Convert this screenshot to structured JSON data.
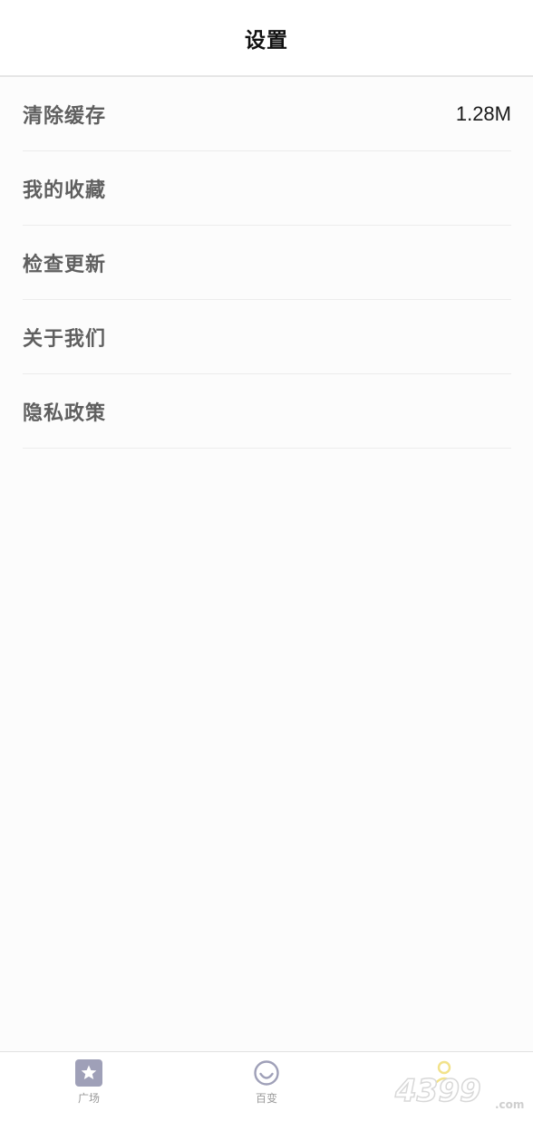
{
  "header": {
    "title": "设置"
  },
  "settings": [
    {
      "label": "清除缓存",
      "value": "1.28M"
    },
    {
      "label": "我的收藏",
      "value": ""
    },
    {
      "label": "检查更新",
      "value": ""
    },
    {
      "label": "关于我们",
      "value": ""
    },
    {
      "label": "隐私政策",
      "value": ""
    }
  ],
  "tabbar": {
    "tabs": [
      {
        "label": "广场",
        "icon": "star-square-icon"
      },
      {
        "label": "百变",
        "icon": "smile-circle-icon"
      },
      {
        "label": "",
        "icon": "person-icon"
      }
    ]
  },
  "watermark": {
    "text": "4399",
    "sub": ".com"
  },
  "colors": {
    "header_bg": "#ffffff",
    "page_bg": "#fcfcfc",
    "label_text": "#5f5f5f",
    "value_text": "#1a1a1a",
    "tab_icon_fill": "#9fa0b8",
    "tab_label": "#9a9a9a",
    "active_accent": "#f2e28a"
  }
}
